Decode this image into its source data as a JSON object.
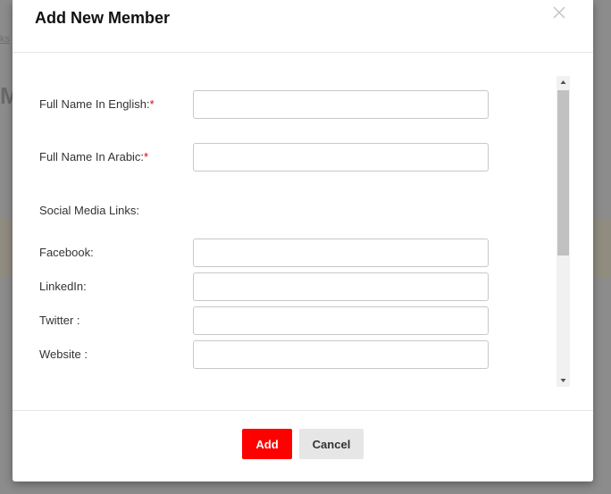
{
  "background": {
    "breadcrumb_fragment": "ks",
    "heading_fragment": "M"
  },
  "modal": {
    "title": "Add New Member",
    "close_icon": "close-icon",
    "fields": {
      "full_name_en": {
        "label": "Full Name In English:",
        "required_mark": "*",
        "value": ""
      },
      "full_name_ar": {
        "label": "Full Name In Arabic:",
        "required_mark": "*",
        "value": ""
      },
      "social_section_label": "Social Media Links:",
      "facebook": {
        "label": "Facebook:",
        "value": ""
      },
      "linkedin": {
        "label": "LinkedIn:",
        "value": ""
      },
      "twitter": {
        "label": "Twitter :",
        "value": ""
      },
      "website": {
        "label": "Website :",
        "value": ""
      }
    },
    "footer": {
      "add_label": "Add",
      "cancel_label": "Cancel"
    }
  },
  "colors": {
    "accent": "#ff0000",
    "required": "#e00000",
    "cancel_bg": "#e6e6e6"
  }
}
